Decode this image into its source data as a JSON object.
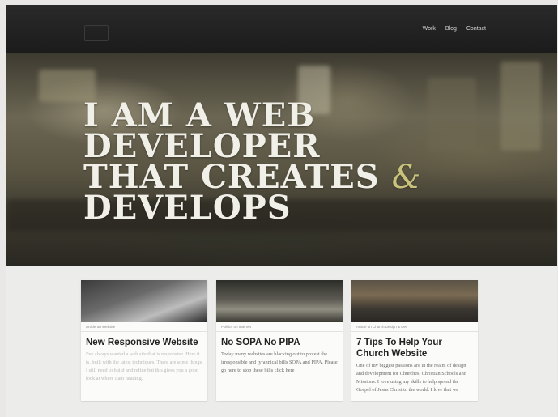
{
  "nav": {
    "items": [
      "Work",
      "Blog",
      "Contact"
    ]
  },
  "hero": {
    "lines": [
      "I AM A WEB",
      "DEVELOPER",
      "THAT CREATES",
      "DEVELOPS"
    ],
    "amp": "&"
  },
  "cards": [
    {
      "meta": "Article on Website",
      "title": "New Responsive Website",
      "excerpt": "I've always wanted a web site that is responsive. Here it is, built with the latest techniques. There are some things I still need to build and refine but this gives you a good look at where I am heading."
    },
    {
      "meta": "Politics on Internet",
      "title": "No SOPA No PIPA",
      "excerpt": "Today many websites are blacking out to protest the irresponsible and tyrannical bills SOPA and PIPA. Please go here to stop these bills click here"
    },
    {
      "meta": "Article on Church Design & Dev",
      "title": "7 Tips To Help Your Church Website",
      "excerpt": "One of my biggest passions are in the realm of design and development for Churches, Christian Schools and Missions. I love using my skills to help spread the Gospel of Jesus Christ to the world. I love that we"
    }
  ]
}
